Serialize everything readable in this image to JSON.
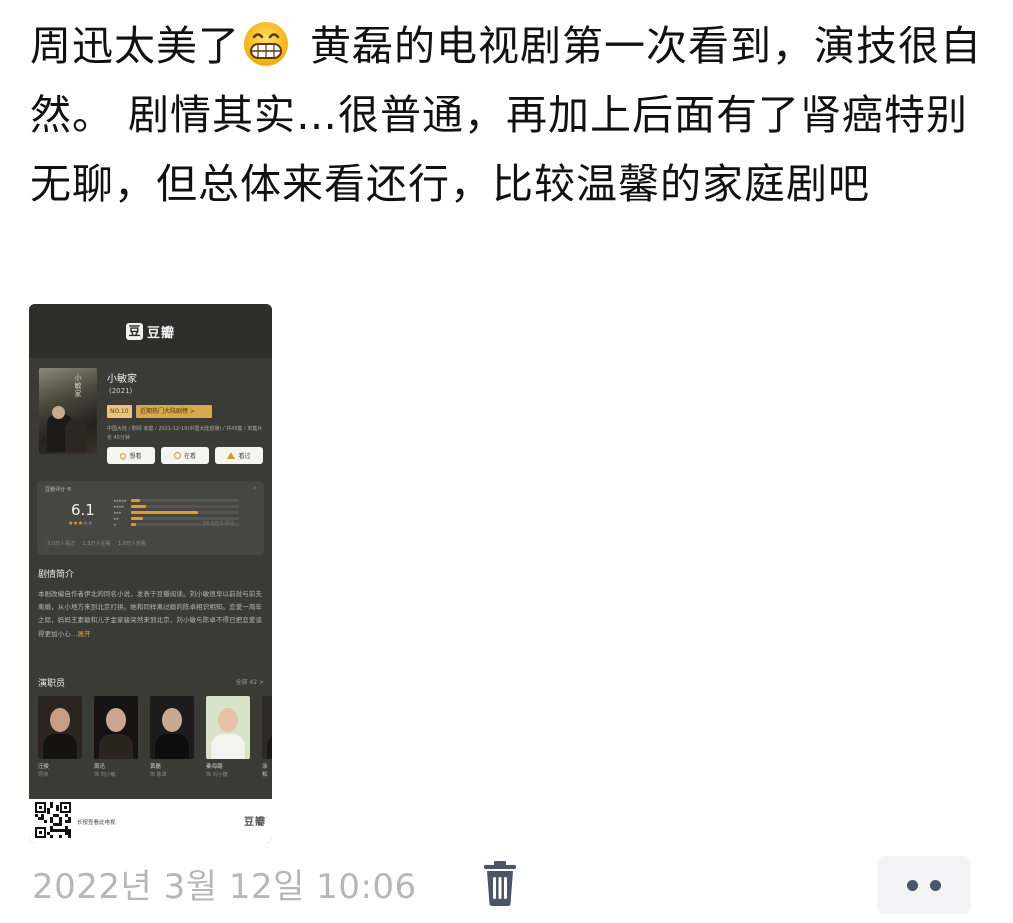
{
  "post": {
    "text_before_emoji": "周迅太美了",
    "emoji": "grinning-face-emoji",
    "text_after_emoji": " 黄磊的电视剧第一次看到，演技很自然。 剧情其实…很普通，再加上后面有了肾癌特别无聊，但总体来看还行，比较温馨的家庭剧吧"
  },
  "card": {
    "app_logo_char": "豆",
    "app_name": "豆瓣",
    "show_title": "小敏家",
    "show_year": "(2021)",
    "rank_badge": "NO.10",
    "rank_link": "近期热门大陆剧榜 >",
    "meta_line": "中国大陆 / 剧情 家庭 / 2021-12-10(中国大陆首播) / 共45集 / 单集片长 45分钟",
    "buttons": {
      "want": "想看",
      "watching": "在看",
      "watched": "看过"
    },
    "rating": {
      "label": "豆瓣评分 ®",
      "score": "6.1",
      "stars_filled": "★★★",
      "stars_empty": "★★",
      "star_level": 3,
      "distribution": [
        0.08,
        0.14,
        0.62,
        0.11,
        0.05
      ],
      "bar_foot": "58.9万人评分",
      "counts": "3.0万人看过 1.3万人在看 1.8万人想看"
    },
    "synopsis_title": "剧情简介",
    "synopsis": "本剧改编自作者伊北的同名小说，发表于豆瓣阅读。刘小敏很早以前就与前夫离婚，从小地方来到北京打拼。她和同样离过婚的陈卓相识相知。恋爱一周年之际，妈妈王素敏和儿子金家骏突然来到北京，刘小敏与陈卓不得已把恋爱谈得更加小心…",
    "synopsis_more": "展开",
    "cast_title": "演职员",
    "cast_all": "全部 42 >",
    "cast": [
      {
        "name": "汪俊",
        "role": "导演"
      },
      {
        "name": "周迅",
        "role": "饰 刘小敏"
      },
      {
        "name": "黄磊",
        "role": "饰 陈卓"
      },
      {
        "name": "秦海璐",
        "role": "饰 刘小捷"
      },
      {
        "name": "涂松",
        "role": ""
      }
    ],
    "footer_text": "长按查看此电视",
    "footer_logo": "豆瓣"
  },
  "meta": {
    "timestamp": "2022년 3월 12일 10:06",
    "delete_icon": "trash-icon",
    "more_icon": "more-dots-icon"
  },
  "colors": {
    "card_bg": "#3b3b36",
    "accent": "#e39a23",
    "timestamp": "#b7b7b7",
    "trash": "#4a5568"
  }
}
